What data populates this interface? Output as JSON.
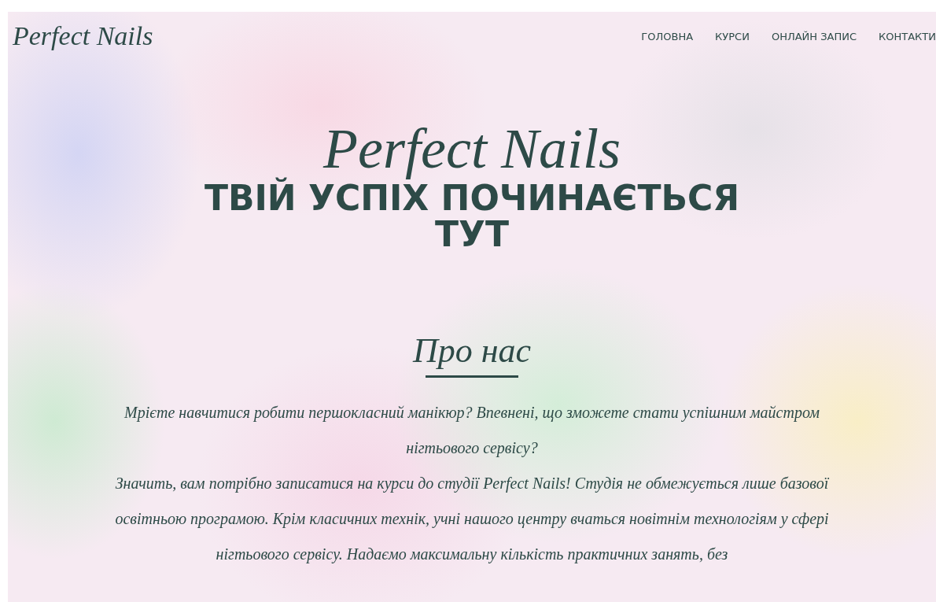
{
  "header": {
    "logo": "Perfect Nails",
    "nav": [
      {
        "label": "ГОЛОВНА"
      },
      {
        "label": "КУРСИ"
      },
      {
        "label": "ОНЛАЙН ЗАПИС"
      },
      {
        "label": "КОНТАКТИ"
      }
    ]
  },
  "hero": {
    "title": "Perfect Nails",
    "tagline": "ТВІЙ УСПІХ ПОЧИНАЄТЬСЯ ТУТ"
  },
  "about": {
    "heading": "Про нас",
    "paragraphs": [
      "Мрієте навчитися робити першокласний манікюр? Впевнені, що зможете стати успішним майстром нігтьового сервісу?",
      "Значить, вам потрібно записатися на курси до студії Perfect Nails! Студія не обмежується лише базової освітньою програмою. Крім класичних технік, учні нашого центру вчаться новітнім технологіям у сфері нігтьового сервісу. Надаємо максимальну кількість практичних занять, без"
    ]
  }
}
